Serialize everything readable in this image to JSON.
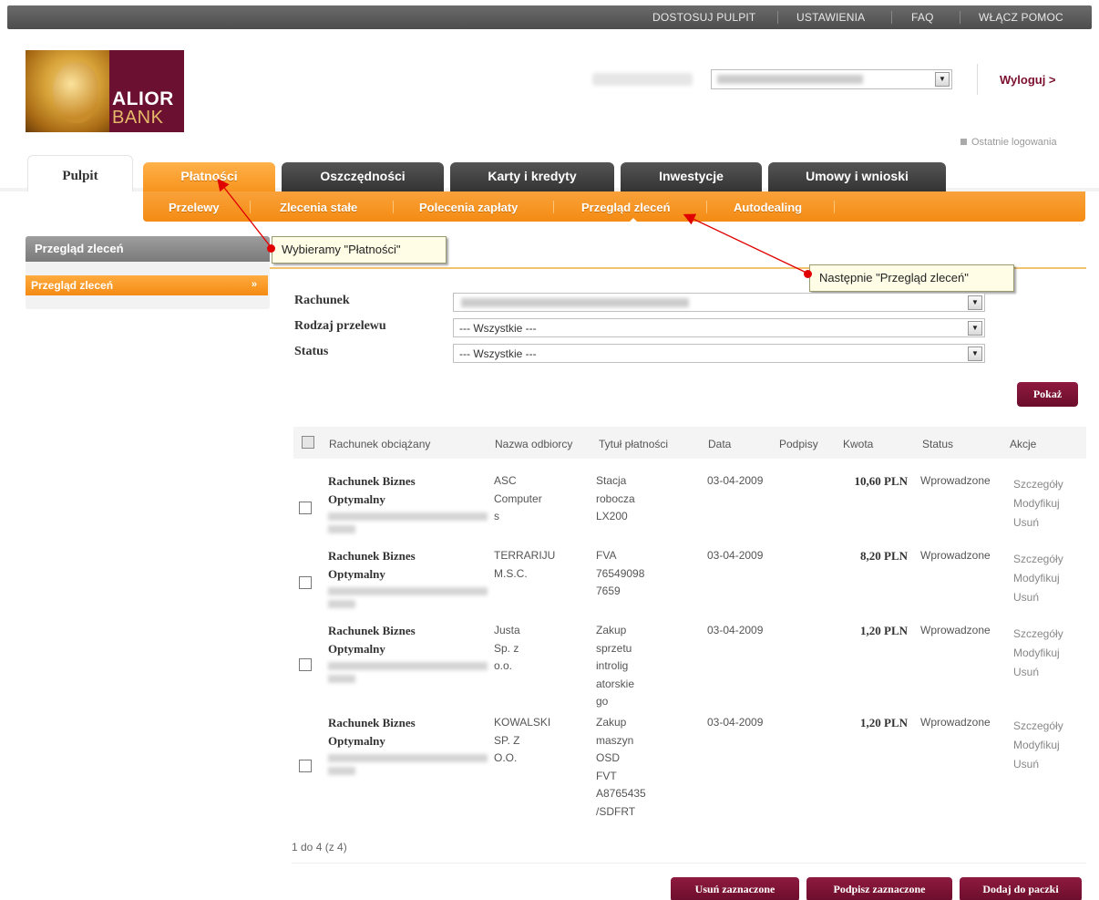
{
  "topnav": {
    "customize": "DOSTOSUJ PULPIT",
    "settings": "USTAWIENIA",
    "faq": "FAQ",
    "help": "WŁĄCZ POMOC"
  },
  "logo": {
    "line1": "ALIOR",
    "line2": "BANK"
  },
  "header": {
    "logout": "Wyloguj >",
    "last_login": "Ostatnie logowania"
  },
  "tabs": [
    "Pulpit",
    "Płatności",
    "Oszczędności",
    "Karty i kredyty",
    "Inwestycje",
    "Umowy i wnioski"
  ],
  "subnav": [
    "Przelewy",
    "Zlecenia stałe",
    "Polecenia zapłaty",
    "Przegląd zleceń",
    "Autodealing"
  ],
  "sidebar": {
    "title": "Przegląd zleceń",
    "item": "Przegląd zleceń",
    "item_arrow": "»"
  },
  "callouts": {
    "first": "Wybieramy \"Płatności\"",
    "second": "Następnie \"Przegląd zleceń\""
  },
  "filters": {
    "account_label": "Rachunek",
    "type_label": "Rodzaj przelewu",
    "type_value": "--- Wszystkie ---",
    "status_label": "Status",
    "status_value": "--- Wszystkie ---"
  },
  "show_button": "Pokaż",
  "table": {
    "headers": [
      "Rachunek obciążany",
      "Nazwa odbiorcy",
      "Tytuł płatności",
      "Data",
      "Podpisy",
      "Kwota",
      "Status",
      "Akcje"
    ],
    "rows": [
      {
        "acc1": "Rachunek Biznes",
        "acc2": "Optymalny",
        "name": [
          "ASC",
          "Computer",
          "s"
        ],
        "title": [
          "Stacja",
          "robocza",
          "LX200"
        ],
        "date": "03-04-2009",
        "amount": "10,60 PLN",
        "status": "Wprowadzone"
      },
      {
        "acc1": "Rachunek Biznes",
        "acc2": "Optymalny",
        "name": [
          "TERRARIJU",
          "M.S.C."
        ],
        "title": [
          "FVA",
          "76549098",
          "7659"
        ],
        "date": "03-04-2009",
        "amount": "8,20 PLN",
        "status": "Wprowadzone"
      },
      {
        "acc1": "Rachunek Biznes",
        "acc2": "Optymalny",
        "name": [
          "Justa",
          "Sp. z",
          "o.o."
        ],
        "title": [
          "Zakup",
          "sprzetu",
          "introlig",
          "atorskie",
          "go"
        ],
        "date": "03-04-2009",
        "amount": "1,20 PLN",
        "status": "Wprowadzone"
      },
      {
        "acc1": "Rachunek Biznes",
        "acc2": "Optymalny",
        "name": [
          "KOWALSKI",
          "SP. Z",
          "O.O."
        ],
        "title": [
          "Zakup",
          "maszyn",
          "OSD",
          "FVT",
          "A8765435",
          "/SDFRT"
        ],
        "date": "03-04-2009",
        "amount": "1,20 PLN",
        "status": "Wprowadzone"
      }
    ],
    "actions": [
      "Szczegóły",
      "Modyfikuj",
      "Usuń"
    ]
  },
  "pager": "1 do 4 (z 4)",
  "bottom_buttons": {
    "delete": "Usuń zaznaczone",
    "sign": "Podpisz zaznaczone",
    "add": "Dodaj do paczki"
  }
}
